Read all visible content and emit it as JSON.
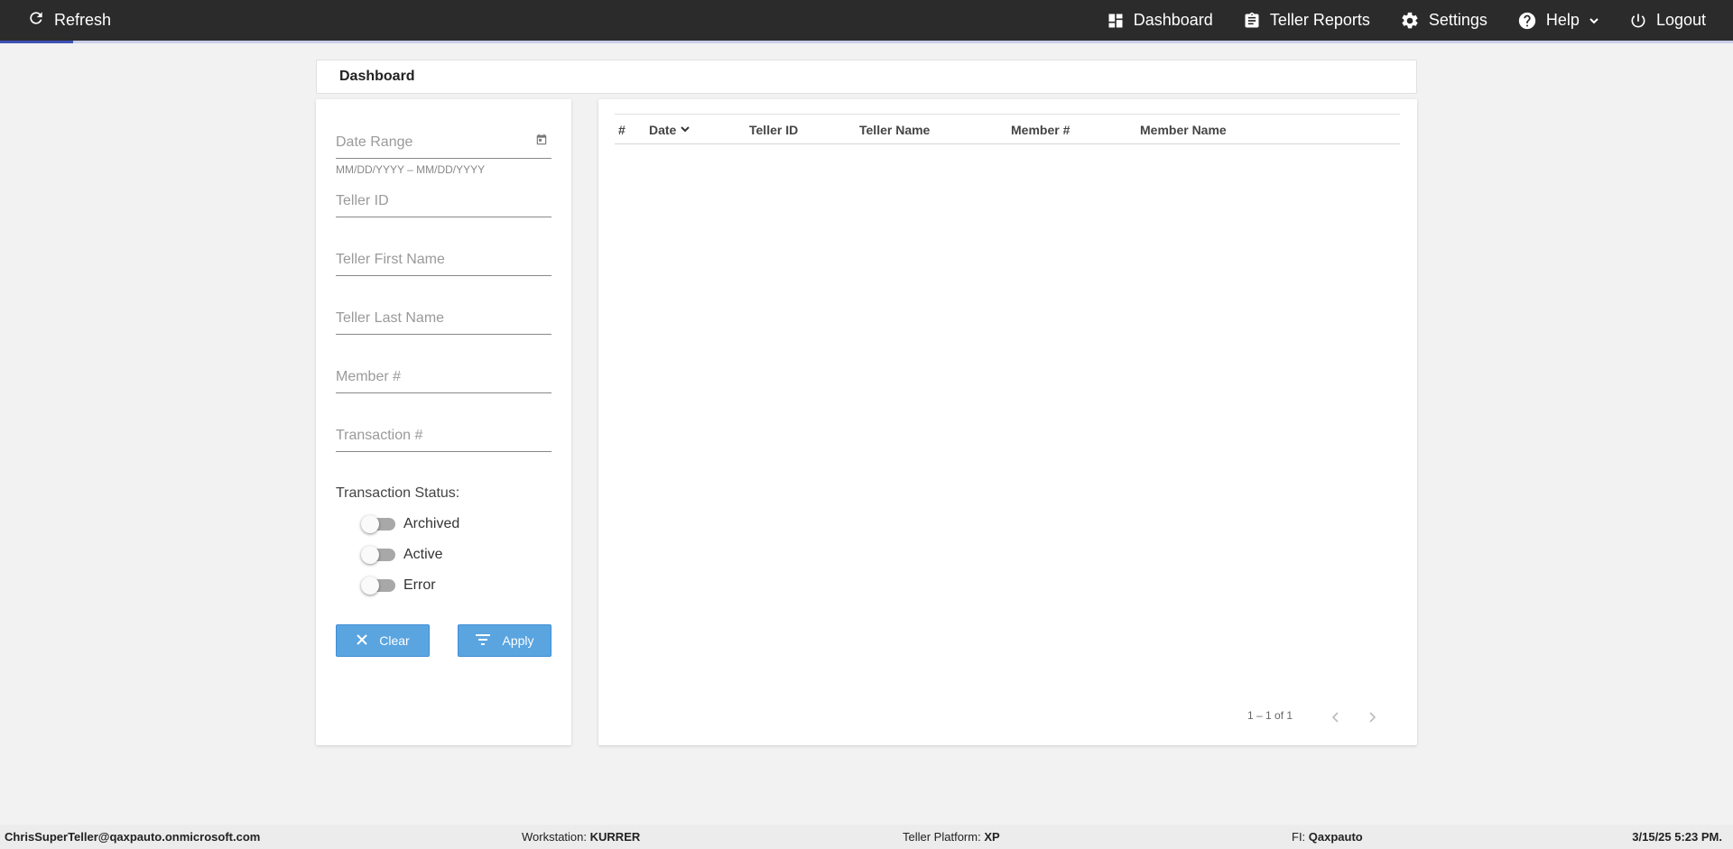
{
  "topbar": {
    "refresh_label": "Refresh",
    "nav": {
      "dashboard": "Dashboard",
      "teller_reports": "Teller Reports",
      "settings": "Settings",
      "help": "Help",
      "logout": "Logout"
    }
  },
  "page": {
    "title": "Dashboard"
  },
  "filters": {
    "date_range_label": "Date Range",
    "date_range_hint": "MM/DD/YYYY – MM/DD/YYYY",
    "teller_id_label": "Teller ID",
    "teller_first_name_label": "Teller First Name",
    "teller_last_name_label": "Teller Last Name",
    "member_num_label": "Member #",
    "transaction_num_label": "Transaction #",
    "status_title": "Transaction Status:",
    "toggles": {
      "archived": "Archived",
      "active": "Active",
      "error": "Error"
    },
    "clear_label": "Clear",
    "apply_label": "Apply"
  },
  "table": {
    "columns": {
      "num": "#",
      "date": "Date",
      "teller_id": "Teller ID",
      "teller_name": "Teller Name",
      "member_num": "Member #",
      "member_name": "Member Name"
    },
    "paginator_label": "1 – 1 of 1"
  },
  "footer": {
    "user": "ChrisSuperTeller@qaxpauto.onmicrosoft.com",
    "workstation_label": "Workstation:",
    "workstation_value": "KURRER",
    "platform_label": "Teller Platform:",
    "platform_value": "XP",
    "fi_label": "FI:",
    "fi_value": "Qaxpauto",
    "datetime": "3/15/25 5:23 PM."
  },
  "colors": {
    "topbar": "#2b2b2b",
    "accent_progress": "#3f51b5",
    "button": "#5aa4e0",
    "background": "#f2f2f2"
  }
}
